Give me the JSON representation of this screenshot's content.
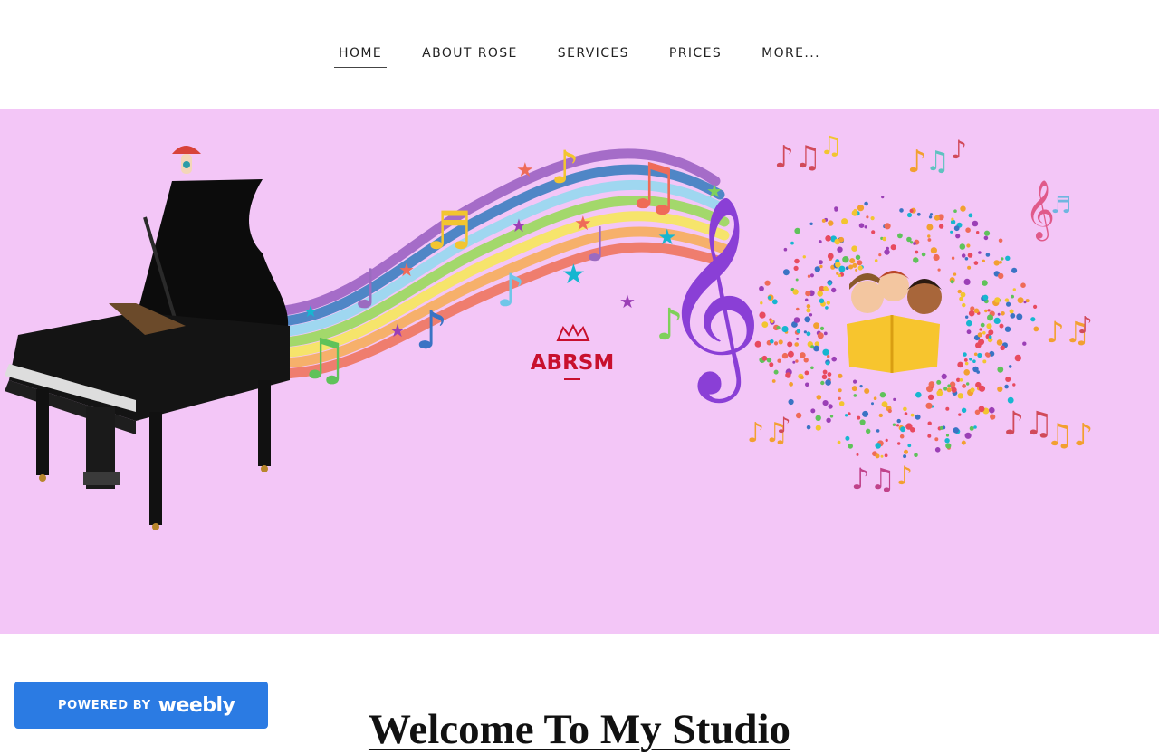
{
  "nav": {
    "items": [
      {
        "label": "HOME",
        "active": true
      },
      {
        "label": "ABOUT ROSE",
        "active": false
      },
      {
        "label": "SERVICES",
        "active": false
      },
      {
        "label": "PRICES",
        "active": false
      },
      {
        "label": "MORE...",
        "active": false
      }
    ]
  },
  "banner": {
    "logo_text": "ABRSM",
    "background": "#f3c6f7"
  },
  "main": {
    "welcome_title": "Welcome To My Studio"
  },
  "badge": {
    "powered_by": "POWERED BY",
    "brand": "weebly",
    "color": "#2b7be3"
  }
}
